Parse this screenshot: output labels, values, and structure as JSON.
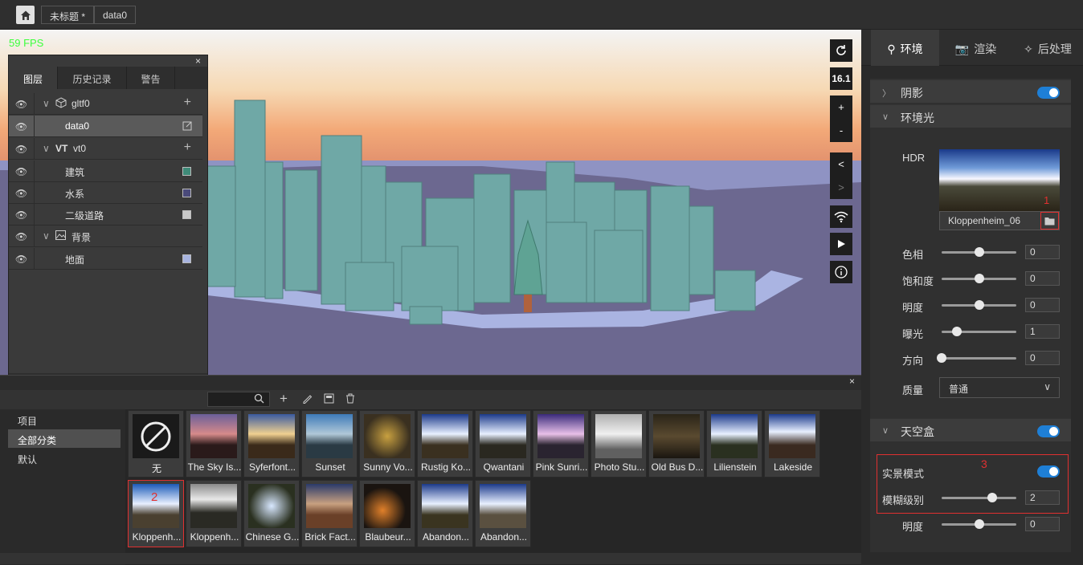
{
  "topbar": {
    "title": "未标题 *",
    "subtitle": "data0"
  },
  "viewport": {
    "fps": "59 FPS",
    "zoom": "16.1",
    "plus": "+",
    "minus": "-",
    "prev": "<",
    "next": ">"
  },
  "layers_panel": {
    "tabs": [
      "图层",
      "历史记录",
      "警告"
    ],
    "rows": [
      {
        "label": "gltf0",
        "kind": "group"
      },
      {
        "label": "data0",
        "kind": "item"
      },
      {
        "label": "vt0",
        "prefix": "VT",
        "kind": "group"
      },
      {
        "label": "建筑",
        "kind": "layer",
        "color": "#3f8a78"
      },
      {
        "label": "水系",
        "kind": "layer",
        "color": "#4a4a7a"
      },
      {
        "label": "二级道路",
        "kind": "layer",
        "color": "#c8c8c8"
      },
      {
        "label": "背景",
        "kind": "group"
      },
      {
        "label": "地面",
        "kind": "layer",
        "color": "#a8b4e0"
      }
    ]
  },
  "assets": {
    "categories": [
      "项目",
      "全部分类",
      "默认"
    ],
    "none_label": "无",
    "items": [
      "The Sky Is...",
      "Syferfont...",
      "Sunset",
      "Sunny Vo...",
      "Rustig Ko...",
      "Qwantani",
      "Pink Sunri...",
      "Photo Stu...",
      "Old Bus D...",
      "Lilienstein",
      "Lakeside",
      "Kloppenh...",
      "Kloppenh...",
      "Chinese G...",
      "Brick Fact...",
      "Blaubeur...",
      "Abandon...",
      "Abandon..."
    ],
    "annotation": "2"
  },
  "right_panel": {
    "tabs": [
      "环境",
      "渲染",
      "后处理"
    ],
    "shadow": "阴影",
    "ambient": "环境光",
    "hdr_label": "HDR",
    "hdr_name": "Kloppenheim_06",
    "annotation1": "1",
    "params": [
      {
        "label": "色相",
        "value": "0",
        "level": 0.5
      },
      {
        "label": "饱和度",
        "value": "0",
        "level": 0.5
      },
      {
        "label": "明度",
        "value": "0",
        "level": 0.5
      },
      {
        "label": "曝光",
        "value": "1",
        "level": 0.2
      },
      {
        "label": "方向",
        "value": "0",
        "level": 0.0
      }
    ],
    "quality_label": "质量",
    "quality_value": "普通",
    "skybox": "天空盒",
    "realmode": "实景模式",
    "annotation3": "3",
    "blur_label": "模糊级别",
    "blur_value": "2",
    "blur_level": 0.68,
    "brightness_label": "明度",
    "brightness_value": "0",
    "brightness_level": 0.5
  }
}
